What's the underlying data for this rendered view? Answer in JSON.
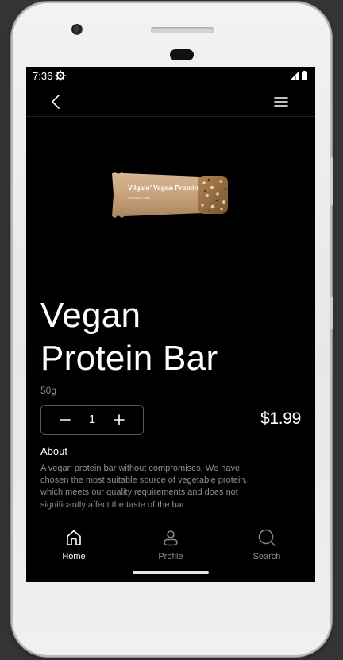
{
  "status_bar": {
    "time": "7:36"
  },
  "product": {
    "title_line1": "Vegan",
    "title_line2": "Protein Bar",
    "weight": "50g",
    "quantity": "1",
    "price": "$1.99",
    "package_brand": "Vilgain",
    "package_name": "Vegan Protein",
    "package_flavor": "Cinnamon Latte"
  },
  "about": {
    "heading": "About",
    "text": "A vegan protein bar without compromises. We have chosen the most suitable source of vegetable protein, which meets our quality requirements and does not significantly affect the taste of the bar."
  },
  "nav": {
    "items": [
      {
        "label": "Home",
        "icon": "home-icon",
        "active": true,
        "color": "#ffffff"
      },
      {
        "label": "Profile",
        "icon": "profile-icon",
        "active": false,
        "color": "#8a8a8a"
      },
      {
        "label": "Search",
        "icon": "search-icon",
        "active": false,
        "color": "#8a8a8a"
      }
    ]
  },
  "colors": {
    "screen_background": "#000000",
    "text_primary": "#ffffff",
    "text_secondary": "#8e8e8e",
    "stepper_border": "#5a5a5a",
    "package_tan": "#c9a581"
  }
}
